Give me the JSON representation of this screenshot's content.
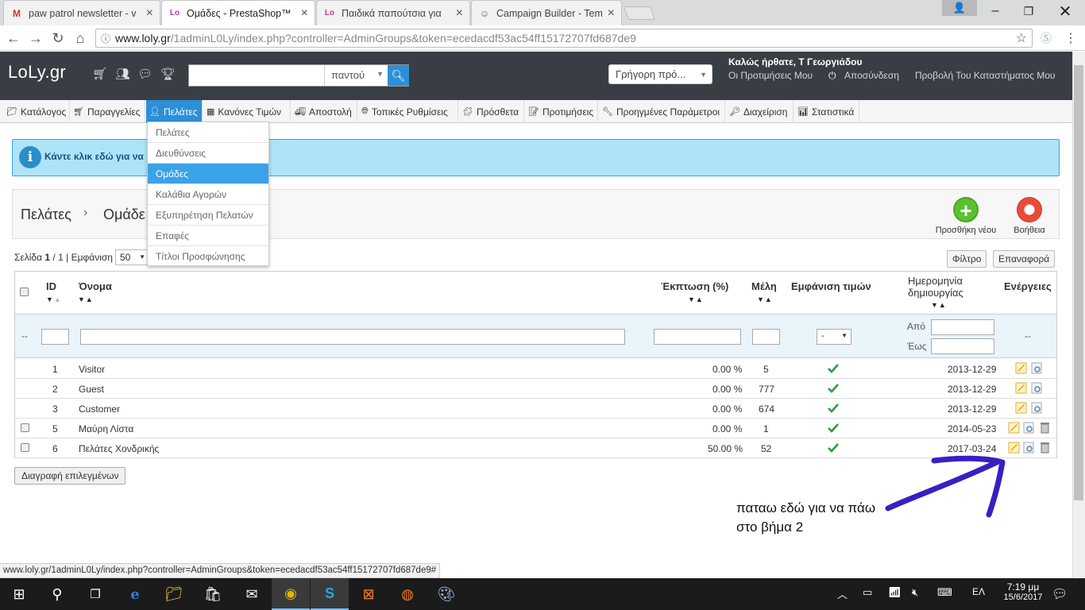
{
  "browser": {
    "tabs": [
      {
        "title": "paw patrol newsletter - v",
        "icon": "gmail-icon"
      },
      {
        "title": "Ομάδες - PrestaShop™",
        "icon": "loly-icon",
        "active": true
      },
      {
        "title": "Παιδικά παπούτσια για",
        "icon": "loly-icon"
      },
      {
        "title": "Campaign Builder - Temp",
        "icon": "mailchimp-icon"
      }
    ],
    "url_host": "www.loly.gr",
    "url_path": "/1adminL0Ly/index.php?controller=AdminGroups&token=ecedacdf53ac54ff15172707fd687de9"
  },
  "header": {
    "logo": "LoLy.gr",
    "search_scope": "παντού",
    "quick_access": "Γρήγορη πρό...",
    "welcome": "Καλώς ήρθατε, Τ Γεωργιάδου",
    "preferences": "Οι Προτιμήσεις Μου",
    "logout": "Αποσύνδεση",
    "view_store": "Προβολή Του Καταστήματος Μου"
  },
  "menu": {
    "items": [
      "Κατάλογος",
      "Παραγγελίες",
      "Πελάτες",
      "Κανόνες Τιμών",
      "Αποστολή",
      "Τοπικές Ρυθμίσεις",
      "Πρόσθετα",
      "Προτιμήσεις",
      "Προηγμένες Παράμετροι",
      "Διαχείριση",
      "Στατιστικά"
    ],
    "active": "Πελάτες",
    "dropdown": [
      "Πελάτες",
      "Διευθύνσεις",
      "Ομάδες",
      "Καλάθια Αγορών",
      "Εξυπηρέτηση Πελατών",
      "Επαφές",
      "Τίτλοι Προσφώνησης"
    ],
    "dropdown_active": "Ομάδες"
  },
  "banner": {
    "text": "Κάντε κλικ εδώ για να"
  },
  "page": {
    "breadcrumb_root": "Πελάτες",
    "breadcrumb_current": "Ομάδε",
    "add_new": "Προσθήκη νέου",
    "help": "Βοήθεια"
  },
  "pager": {
    "prefix": "Σελίδα",
    "current": "1",
    "total": "1",
    "show_label": "Εμφάνιση",
    "per_page": "50",
    "filter_button": "Φίλτρο",
    "reset_button": "Επαναφορά"
  },
  "table": {
    "headers": {
      "id": "ID",
      "name": "Όνομα",
      "discount": "Έκπτωση (%)",
      "members": "Μέλη",
      "show_prices": "Εμφάνιση τιμών",
      "created_line1": "Ημερομηνία",
      "created_line2": "δημιουργίας",
      "actions": "Ενέργειες"
    },
    "filter": {
      "dash": "--",
      "select_value": "-",
      "from": "Από",
      "to": "Έως",
      "actions_dash": "--"
    },
    "rows": [
      {
        "id": "1",
        "name": "Visitor",
        "discount": "0.00 %",
        "members": "5",
        "date": "2013-12-29",
        "deletable": false
      },
      {
        "id": "2",
        "name": "Guest",
        "discount": "0.00 %",
        "members": "777",
        "date": "2013-12-29",
        "deletable": false
      },
      {
        "id": "3",
        "name": "Customer",
        "discount": "0.00 %",
        "members": "674",
        "date": "2013-12-29",
        "deletable": false
      },
      {
        "id": "5",
        "name": "Μαύρη Λίστα",
        "discount": "0.00 %",
        "members": "1",
        "date": "2014-05-23",
        "deletable": true
      },
      {
        "id": "6",
        "name": "Πελάτες Χονδρικής",
        "discount": "50.00 %",
        "members": "52",
        "date": "2017-03-24",
        "deletable": true
      }
    ],
    "delete_selected": "Διαγραφή επιλεγμένων"
  },
  "annotation": {
    "line1": "παταω εδώ για να πάω",
    "line2": "στο βήμα 2",
    "color": "#3a1fc1"
  },
  "status_url": "www.loly.gr/1adminL0Ly/index.php?controller=AdminGroups&token=ecedacdf53ac54ff15172707fd687de9#",
  "taskbar": {
    "time": "7:19 μμ",
    "date": "15/6/2017",
    "lang": "ΕΛ"
  },
  "colors": {
    "accent": "#2d8fd6",
    "header_bg": "#383e44",
    "banner_bg": "#aee3f8",
    "check": "#2e9b3f"
  }
}
